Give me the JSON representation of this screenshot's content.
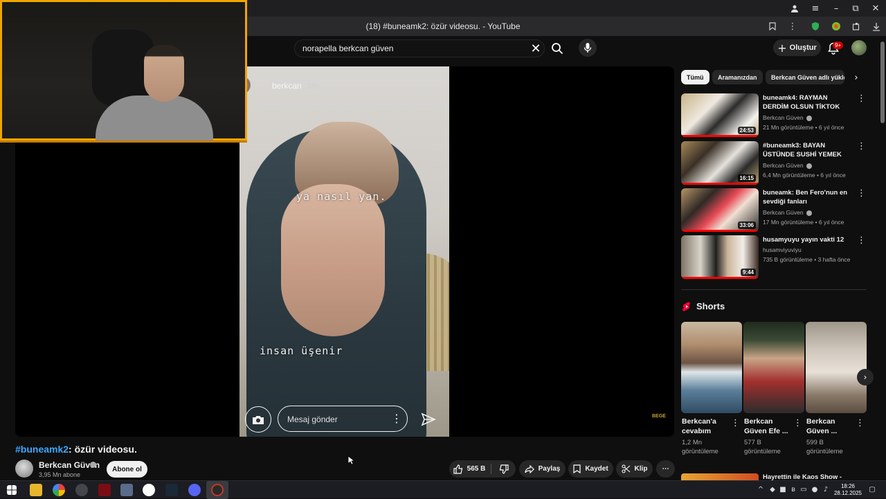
{
  "browser": {
    "tab_title": "(18) #buneamk2: özür videosu. - YouTube",
    "window_controls": {
      "minimize": "–",
      "restore": "⧉",
      "close": "✕",
      "menu": "≡"
    }
  },
  "header": {
    "search": {
      "value": "norapella berkcan güven",
      "clear_icon": "✕"
    },
    "create_label": "Oluştur",
    "notification_badge": "9+"
  },
  "player": {
    "story_user": "berkcan",
    "story_age": "19s",
    "caption_top": "ya nasıl yan.",
    "caption_bottom": "insan üşenir",
    "message_placeholder": "Mesaj gönder",
    "watermark": "BEGE"
  },
  "video": {
    "title_tag": "#buneamk2",
    "title_rest": ": özür videosu.",
    "channel_name": "Berkcan Güven",
    "subscribers": "3,95 Mn abone",
    "subscribe_label": "Abone ol",
    "like_count": "565 B",
    "share_label": "Paylaş",
    "save_label": "Kaydet",
    "clip_label": "Klip",
    "more_label": "⋯"
  },
  "sidebar": {
    "chips": [
      "Tümü",
      "Aramanızdan",
      "Berkcan Güven adlı yükleyiciden"
    ],
    "recommendations": [
      {
        "title": "buneamk4: RAYMAN DERDİM OLSUN TİKTOK",
        "channel": "Berkcan Güven",
        "meta": "21 Mn görüntüleme • 6 yıl önce",
        "duration": "24:53",
        "verified": true,
        "progress": 1.0
      },
      {
        "title": "#buneamk3: BAYAN ÜSTÜNDE SUSHİ YEMEK",
        "channel": "Berkcan Güven",
        "meta": "6,4 Mn görüntüleme • 6 yıl önce",
        "duration": "16:15",
        "verified": true,
        "progress": 1.0
      },
      {
        "title": "buneamk: Ben Fero'nun en sevdiği fanları",
        "channel": "Berkcan Güven",
        "meta": "17 Mn görüntüleme • 6 yıl önce",
        "duration": "33:06",
        "verified": true,
        "progress": 1.0
      },
      {
        "title": "husamyuyu yayın vakti 12",
        "channel": "husamviyuviyu",
        "meta": "735 B görüntüleme • 3 hafta önce",
        "duration": "9:44",
        "verified": false,
        "progress": 1.0
      }
    ],
    "shorts_title": "Shorts",
    "shorts": [
      {
        "title": "Berkcan'a cevabım",
        "views": "1,2 Mn görüntüleme"
      },
      {
        "title": "Berkcan Güven Efe ...",
        "views": "577 B görüntüleme"
      },
      {
        "title": "Berkcan Güven ...",
        "views": "599 B görüntüleme"
      }
    ],
    "next_title": "Hayrettin ile Kaos Show -"
  },
  "taskbar": {
    "time": "18:26",
    "date": "28.12.2025"
  },
  "colors": {
    "accent_red": "#ff0000",
    "link_blue": "#3ea6ff",
    "webcam_border": "#f1a500"
  }
}
